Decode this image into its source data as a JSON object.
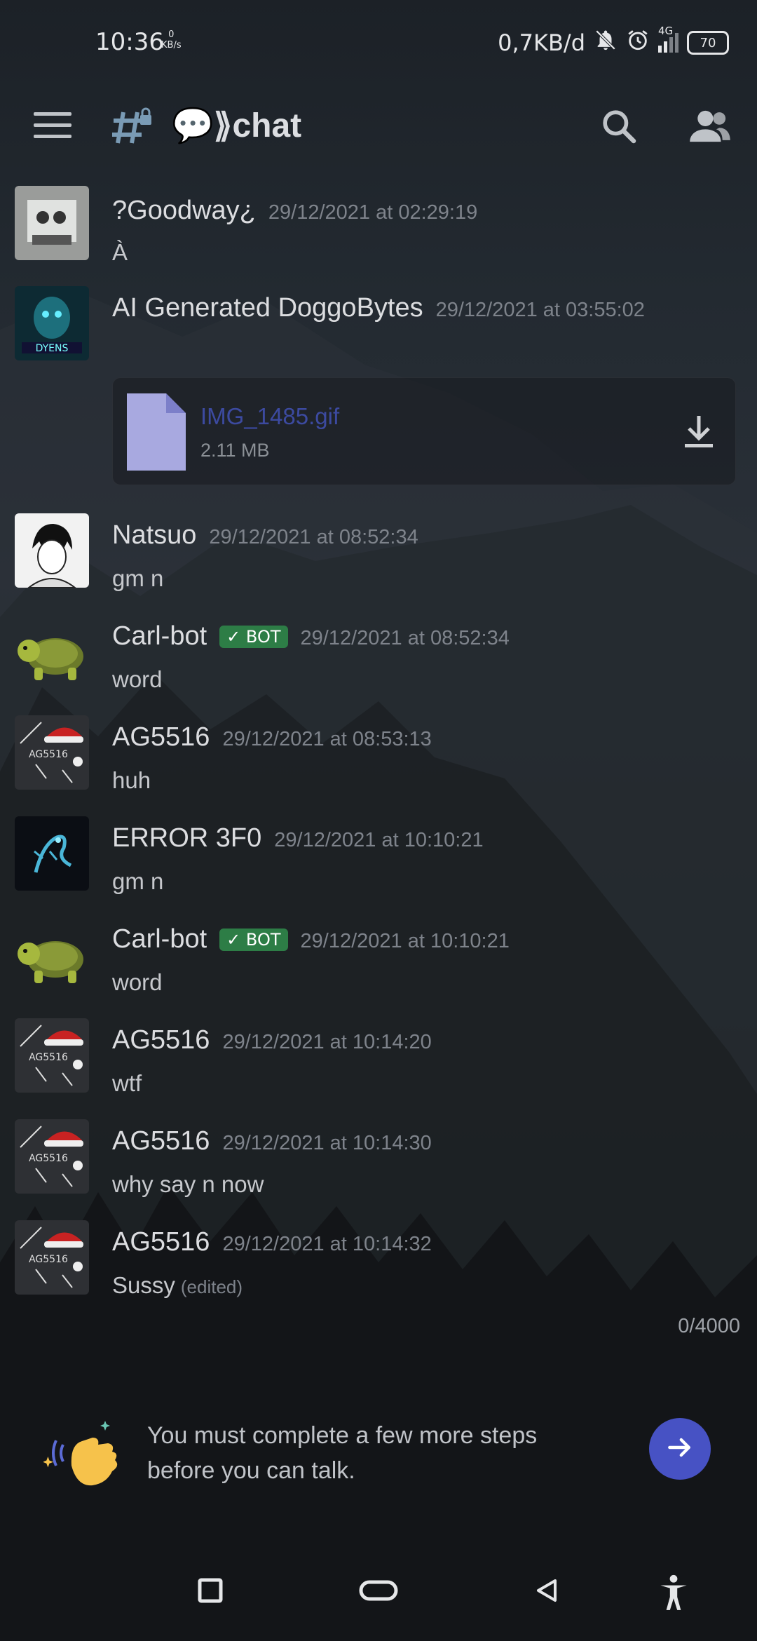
{
  "status_bar": {
    "time": "10:36",
    "kbs_value": "0",
    "kbs_unit": "KB/s",
    "net_speed": "0,7KB/d",
    "network": "4G",
    "battery": "70",
    "icons": [
      "mute-bell-icon",
      "alarm-icon",
      "signal-icon",
      "battery-icon"
    ]
  },
  "header": {
    "channel_name": "💬⟫chat",
    "icons": [
      "menu-icon",
      "locked-channel-icon",
      "search-icon",
      "members-icon"
    ]
  },
  "messages": [
    {
      "username": "?Goodway¿",
      "timestamp": "29/12/2021 at 02:29:19",
      "text": "À",
      "bot": false
    },
    {
      "username": "AI Generated DoggoBytes",
      "timestamp": "29/12/2021 at 03:55:02",
      "text": "",
      "bot": false,
      "attachment": {
        "name": "IMG_1485.gif",
        "size": "2.11 MB"
      }
    },
    {
      "username": "Natsuo",
      "timestamp": "29/12/2021 at 08:52:34",
      "text": "gm n",
      "bot": false
    },
    {
      "username": "Carl-bot",
      "timestamp": "29/12/2021 at 08:52:34",
      "text": "word",
      "bot": true,
      "bot_label": "BOT"
    },
    {
      "username": "AG5516",
      "timestamp": "29/12/2021 at 08:53:13",
      "text": "huh",
      "bot": false
    },
    {
      "username": "ERROR 3F0",
      "timestamp": "29/12/2021 at 10:10:21",
      "text": "gm n",
      "bot": false
    },
    {
      "username": "Carl-bot",
      "timestamp": "29/12/2021 at 10:10:21",
      "text": "word",
      "bot": true,
      "bot_label": "BOT"
    },
    {
      "username": "AG5516",
      "timestamp": "29/12/2021 at 10:14:20",
      "text": "wtf",
      "bot": false
    },
    {
      "username": "AG5516",
      "timestamp": "29/12/2021 at 10:14:30",
      "text": "why say n now",
      "bot": false
    },
    {
      "username": "AG5516",
      "timestamp": "29/12/2021 at 10:14:32",
      "text": "Sussy",
      "edited": "(edited)",
      "bot": false
    }
  ],
  "composer": {
    "char_counter": "0/4000",
    "notice": "You must complete a few more steps before you can talk.",
    "send_button": "arrow-right-icon"
  },
  "nav_bar": {
    "buttons": [
      "recents-icon",
      "home-icon",
      "back-icon",
      "accessibility-icon"
    ]
  },
  "colors": {
    "accent": "#4752c4",
    "bot_tag": "#2d7d46",
    "timestamp": "#7e838b"
  }
}
